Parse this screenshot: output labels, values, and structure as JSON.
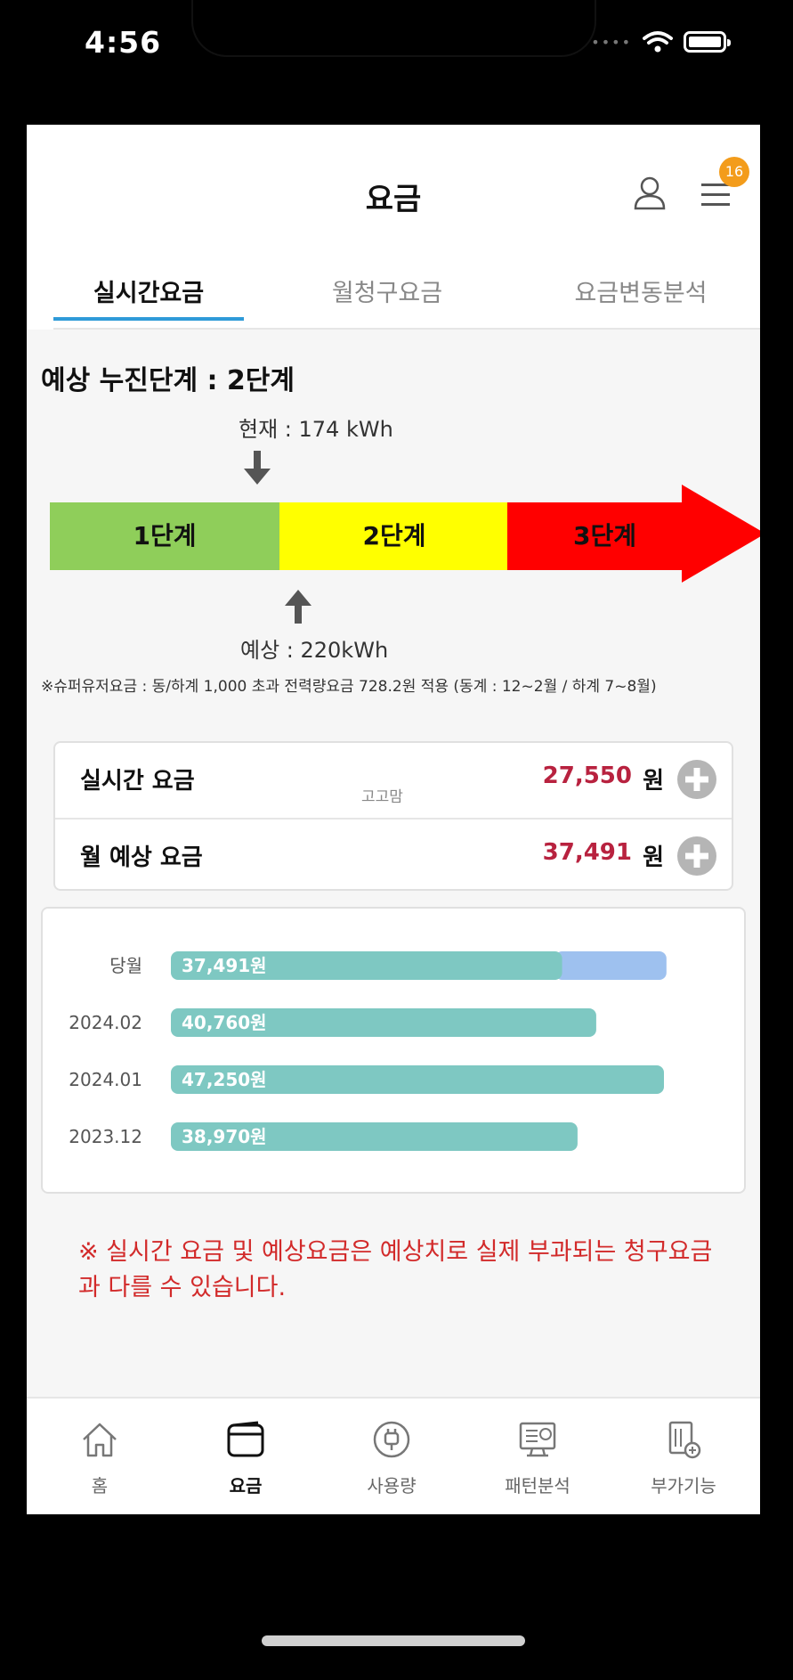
{
  "status": {
    "time": "4:56"
  },
  "header": {
    "title": "요금",
    "badge": "16"
  },
  "tabs": [
    {
      "label": "실시간요금"
    },
    {
      "label": "월청구요금"
    },
    {
      "label": "요금변동분석"
    }
  ],
  "stage": {
    "title": "예상 누진단계 : 2단계",
    "current_label": "현재 : 174 kWh",
    "expect_label": "예상 :  220kWh",
    "stages": [
      "1단계",
      "2단계",
      "3단계"
    ],
    "colors": [
      "#8fce5a",
      "#ffff00",
      "#ff0000"
    ],
    "note": "※슈퍼유저요금 : 동/하계 1,000 초과 전력량요금 728.2원 적용 (동계 : 12~2월 / 하계 7~8월)"
  },
  "fees": {
    "realtime_label": "실시간 요금",
    "realtime_value": "27,550",
    "monthly_label": "월 예상 요금",
    "monthly_value": "37,491",
    "unit": "원",
    "watermark": "고고맘"
  },
  "chart_data": {
    "type": "bar",
    "orientation": "horizontal",
    "categories": [
      "당월",
      "2024.02",
      "2024.01",
      "2023.12"
    ],
    "values": [
      37491,
      40760,
      47250,
      38970
    ],
    "labels": [
      "37,491원",
      "40,760원",
      "47,250원",
      "38,970원"
    ],
    "projection_extra": [
      10000,
      0,
      0,
      0
    ],
    "xlim": [
      0,
      47250
    ],
    "colors": {
      "bar": "#7ec8c2",
      "projection": "#9ec1ef"
    }
  },
  "warning": "※ 실시간 요금 및 예상요금은 예상치로 실제 부과되는 청구요금과 다를 수 있습니다.",
  "nav": [
    {
      "label": "홈",
      "icon": "home-icon"
    },
    {
      "label": "요금",
      "icon": "wallet-icon"
    },
    {
      "label": "사용량",
      "icon": "plug-icon"
    },
    {
      "label": "패턴분석",
      "icon": "monitor-chart-icon"
    },
    {
      "label": "부가기능",
      "icon": "document-plus-icon"
    }
  ]
}
